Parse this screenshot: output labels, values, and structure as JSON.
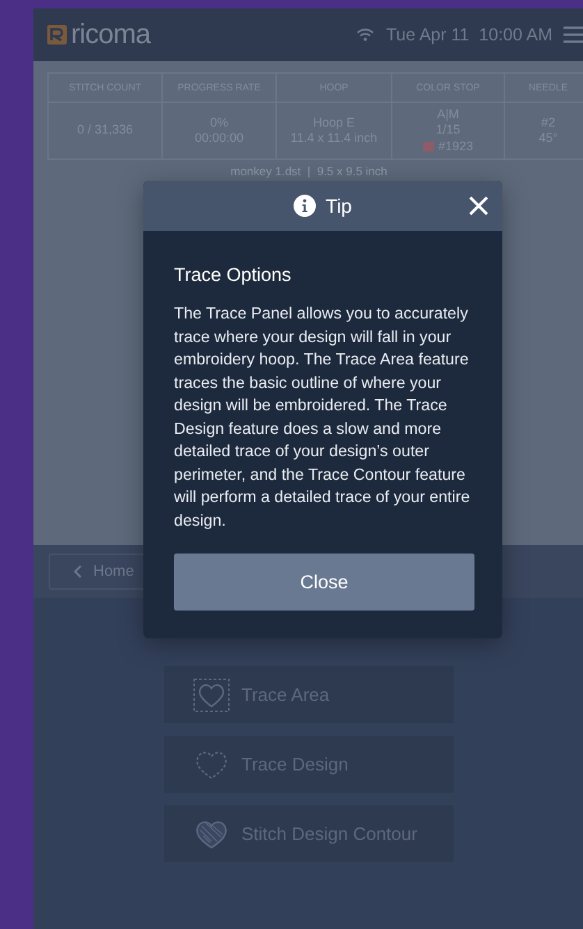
{
  "header": {
    "logo": "ricoma",
    "datetime": "Tue Apr 11  10:00 AM"
  },
  "stats": {
    "columns": [
      "STITCH COUNT",
      "PROGRESS RATE",
      "HOOP",
      "COLOR STOP",
      "NEEDLE"
    ],
    "cells": [
      {
        "lines": [
          "0 / 31,336"
        ],
        "swatch": false
      },
      {
        "lines": [
          "0%",
          "00:00:00"
        ],
        "swatch": false
      },
      {
        "lines": [
          "Hoop E",
          "11.4 x 11.4 inch"
        ],
        "swatch": false
      },
      {
        "lines": [
          "A|M",
          "1/15",
          "#1923"
        ],
        "swatch": true
      },
      {
        "lines": [
          "#2",
          "45°"
        ],
        "swatch": false
      }
    ]
  },
  "file_info": "monkey 1.dst  |  9.5 x 9.5 inch",
  "toolbar": {
    "back": "Home"
  },
  "trace_options": [
    {
      "kind": "area",
      "label": "Trace Area"
    },
    {
      "kind": "design",
      "label": "Trace Design"
    },
    {
      "kind": "contour",
      "label": "Stitch Design Contour"
    }
  ],
  "tip": {
    "title": "Tip",
    "heading": "Trace Options",
    "body": "The Trace Panel allows you to accurately trace where your design will fall in your embroidery hoop. The Trace Area feature traces the basic outline of where your design will be embroidered. The Trace Design feature does a slow and more detailed trace of your design’s outer perimeter, and the Trace Contour feature will perform a detailed trace of your entire design.",
    "button": "Close"
  }
}
